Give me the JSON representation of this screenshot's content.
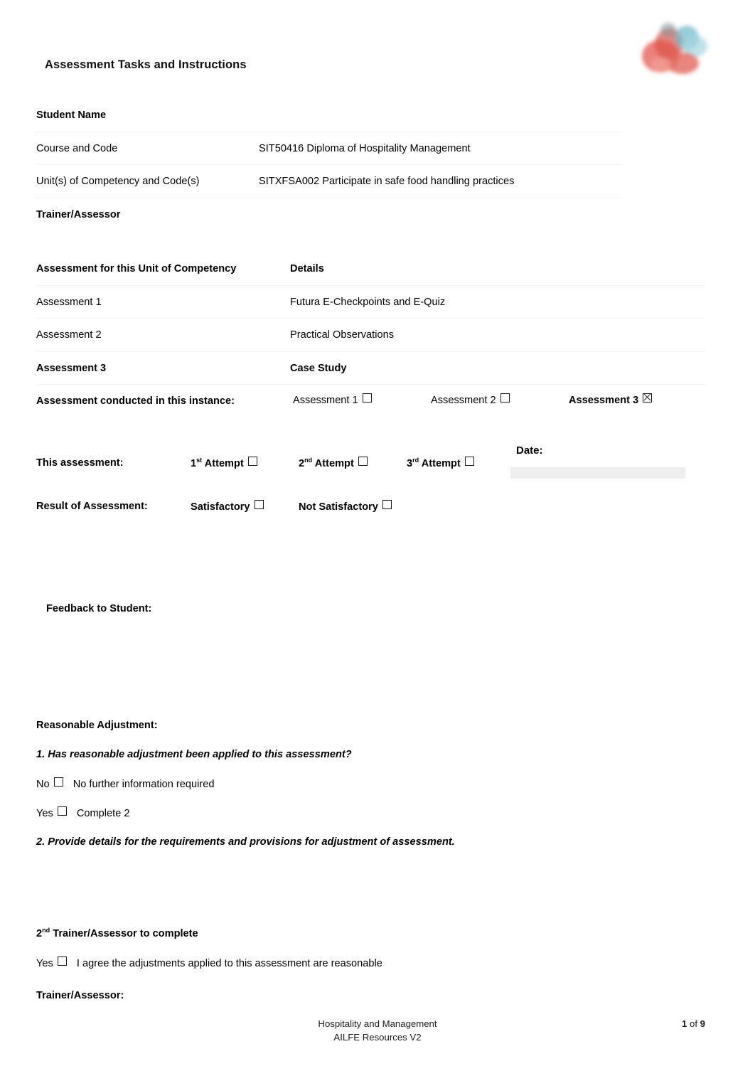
{
  "document": {
    "title": "Assessment Tasks and Instructions"
  },
  "logo": {
    "name": "organisation-logo"
  },
  "student_details": {
    "rows": [
      {
        "label": "Student Name",
        "value": "",
        "bold": true
      },
      {
        "label": "Course and Code",
        "value": "SIT50416 Diploma of Hospitality Management",
        "bold": false
      },
      {
        "label": "Unit(s) of Competency and Code(s)",
        "value": "SITXFSA002 Participate in safe food handling practices",
        "bold": false
      },
      {
        "label": "Trainer/Assessor",
        "value": "",
        "bold": true
      }
    ]
  },
  "assessments": {
    "header": {
      "column_1": "Assessment for this Unit of Competency",
      "column_2": "Details"
    },
    "rows": [
      {
        "label": "Assessment 1",
        "detail": "Futura E-Checkpoints and E-Quiz"
      },
      {
        "label": "Assessment 2",
        "detail": "Practical Observations"
      },
      {
        "label": "Assessment 3",
        "detail": "Case Study"
      }
    ],
    "instance": {
      "label": "Assessment conducted in this instance:",
      "options": [
        {
          "label": "Assessment 1",
          "checked": false
        },
        {
          "label": "Assessment 2",
          "checked": false
        },
        {
          "label": "Assessment 3",
          "checked": true
        }
      ]
    }
  },
  "assessment_record": {
    "this_assessment_label": "This assessment:",
    "attempts": [
      {
        "ordinal": "1",
        "suffix": "st",
        "label": " Attempt",
        "checked": false
      },
      {
        "ordinal": "2",
        "suffix": "nd",
        "label": " Attempt",
        "checked": false
      },
      {
        "ordinal": "3",
        "suffix": "rd",
        "label": " Attempt",
        "checked": false
      }
    ],
    "date_label": "Date:",
    "date_value": "",
    "result_label": "Result of Assessment:",
    "results": [
      {
        "label": "Satisfactory",
        "checked": false
      },
      {
        "label": "Not Satisfactory",
        "checked": false
      }
    ],
    "feedback_label": "Feedback to Student:",
    "feedback_value": ""
  },
  "reasonable_adjustment": {
    "heading": "Reasonable Adjustment:",
    "question_1": "1.    Has reasonable adjustment been applied to this assessment?",
    "answer_no": {
      "prefix": "No",
      "text": "No further information required",
      "checked": false
    },
    "answer_yes": {
      "prefix": "Yes",
      "text": "Complete 2",
      "checked": false
    },
    "question_2": "2.    Provide details for the requirements and provisions for adjustment of assessment.",
    "details_value": "",
    "second_assessor_heading_ordinal": "2",
    "second_assessor_heading_suffix": "nd",
    "second_assessor_heading_rest": " Trainer/Assessor to complete",
    "agree": {
      "prefix": "Yes",
      "text": "I agree the adjustments applied to this assessment are reasonable",
      "checked": false
    },
    "signature_label": "Trainer/Assessor:",
    "signature_value": ""
  },
  "footer": {
    "line_1": "Hospitality and Management",
    "line_2": "AILFE Resources V2",
    "page_current": "1",
    "page_of": "of",
    "page_total": "9"
  }
}
